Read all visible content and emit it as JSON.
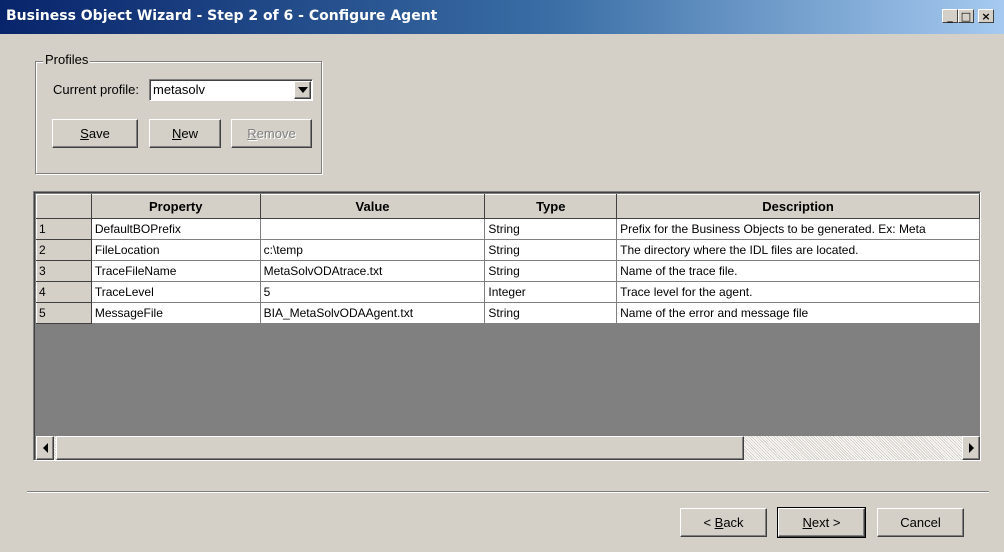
{
  "window": {
    "title": "Business Object Wizard - Step 2 of 6 - Configure Agent",
    "controls": {
      "minimize": "_",
      "maximize": "□",
      "close": "×"
    }
  },
  "profiles": {
    "group_label": "Profiles",
    "current_label": "Current profile:",
    "current_value": "metasolv",
    "save_mn": "S",
    "save_rest": "ave",
    "new_mn": "N",
    "new_rest": "ew",
    "remove_mn": "R",
    "remove_rest": "emove"
  },
  "grid": {
    "columns": [
      "",
      "Property",
      "Value",
      "Type",
      "Description"
    ],
    "rows": [
      {
        "num": "1",
        "property": "DefaultBOPrefix",
        "value": "",
        "type": "String",
        "description": "Prefix for the Business Objects to be generated. Ex: Meta"
      },
      {
        "num": "2",
        "property": "FileLocation",
        "value": "c:\\temp",
        "type": "String",
        "description": "The directory where the IDL files are located."
      },
      {
        "num": "3",
        "property": "TraceFileName",
        "value": "MetaSolvODAtrace.txt",
        "type": "String",
        "description": "Name of the trace file."
      },
      {
        "num": "4",
        "property": "TraceLevel",
        "value": "5",
        "type": "Integer",
        "description": "Trace level for the agent."
      },
      {
        "num": "5",
        "property": "MessageFile",
        "value": "BIA_MetaSolvODAAgent.txt",
        "type": "String",
        "description": "Name of the error and message file"
      }
    ]
  },
  "footer": {
    "back_pre": "< ",
    "back_mn": "B",
    "back_rest": "ack",
    "next_mn": "N",
    "next_rest": "ext >",
    "cancel_label": "Cancel"
  },
  "colors": {
    "title_start": "#08246b",
    "title_end": "#a6caf0",
    "face": "#d4d0c8"
  }
}
